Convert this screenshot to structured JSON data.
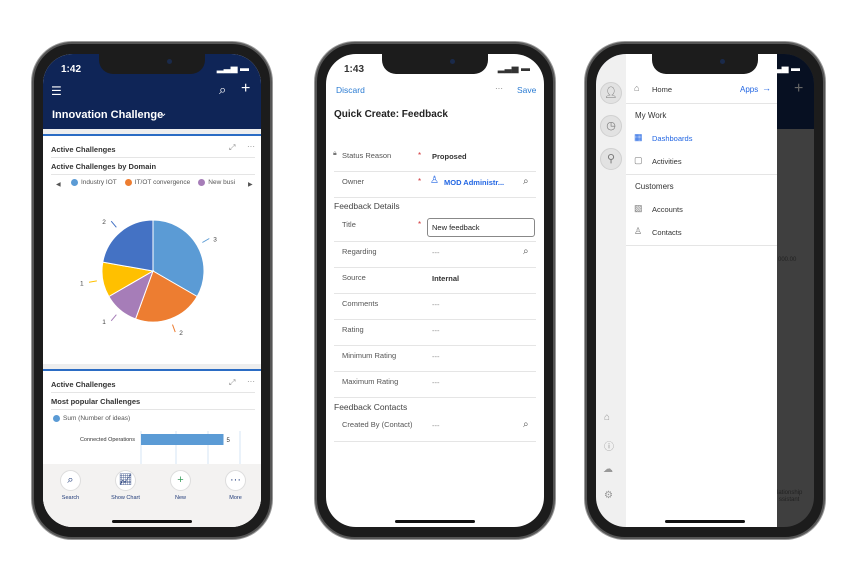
{
  "phone1": {
    "time": "1:42",
    "app_title": "Innovation Challenge",
    "card1": {
      "header": "Active Challenges",
      "chart_title": "Active Challenges by Domain",
      "legend": [
        {
          "label": "Industry IOT",
          "color": "#5b9bd5"
        },
        {
          "label": "IT/OT convergence",
          "color": "#ed7d31"
        },
        {
          "label": "New busi",
          "color": "#a67db8"
        }
      ]
    },
    "card2": {
      "header": "Active Challenges",
      "chart_title": "Most popular Challenges",
      "legend": "Sum (Number of ideas)"
    },
    "chart_data": [
      {
        "type": "pie",
        "slices": [
          {
            "value": 3,
            "color": "#5b9bd5",
            "label": "3"
          },
          {
            "value": 2,
            "color": "#ed7d31",
            "label": "2"
          },
          {
            "value": 1,
            "color": "#a67db8",
            "label": "1"
          },
          {
            "value": 1,
            "color": "#ffc000",
            "label": "1"
          },
          {
            "value": 2,
            "color": "#4472c4",
            "label": "2"
          }
        ]
      },
      {
        "type": "bar",
        "categories": [
          "Connected Operations"
        ],
        "values": [
          5
        ],
        "series_name": "Sum (Number of ideas)"
      }
    ],
    "bottom": [
      {
        "label": "Search",
        "icon": "search-icon"
      },
      {
        "label": "Show Chart",
        "icon": "chart-icon"
      },
      {
        "label": "New",
        "icon": "plus-icon"
      },
      {
        "label": "More",
        "icon": "more-icon"
      }
    ]
  },
  "phone2": {
    "time": "1:43",
    "discard": "Discard",
    "save": "Save",
    "more": "···",
    "title": "Quick Create: Feedback",
    "fields": [
      {
        "label": "Status Reason",
        "value": "Proposed",
        "required": true
      },
      {
        "label": "Owner",
        "value": "MOD Administr...",
        "required": true
      }
    ],
    "section1": "Feedback Details",
    "details": [
      {
        "label": "Title",
        "value": "New feedback",
        "required": true
      },
      {
        "label": "Regarding",
        "value": "---"
      },
      {
        "label": "Source",
        "value": "Internal"
      },
      {
        "label": "Comments",
        "value": "---"
      },
      {
        "label": "Rating",
        "value": "---"
      },
      {
        "label": "Minimum Rating",
        "value": "---"
      },
      {
        "label": "Maximum Rating",
        "value": "---"
      }
    ],
    "section2": "Feedback Contacts",
    "contacts": [
      {
        "label": "Created By (Contact)",
        "value": "---"
      }
    ]
  },
  "phone3": {
    "home": "Home",
    "apps": "Apps",
    "my_work": "My Work",
    "dashboards": "Dashboards",
    "activities": "Activities",
    "customers": "Customers",
    "accounts": "Accounts",
    "contacts": "Contacts",
    "bg_value": "000.00",
    "bg_button1": "lationship",
    "bg_button2": "ssistant",
    "accent": "#2266e3"
  }
}
